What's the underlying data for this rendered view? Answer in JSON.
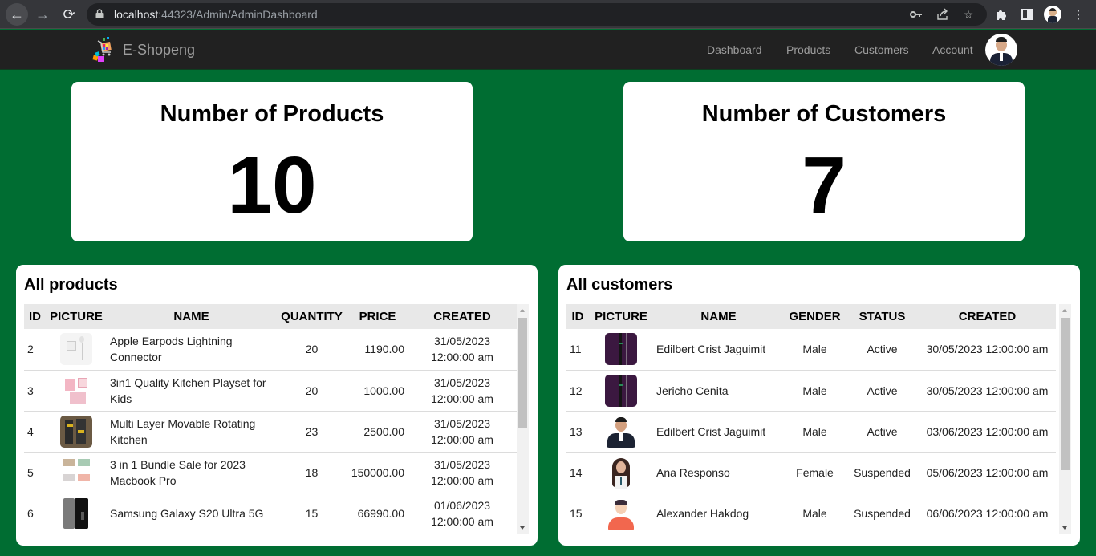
{
  "browser": {
    "url_host": "localhost",
    "url_rest": ":44323/Admin/AdminDashboard",
    "icons": [
      "back-arrow-icon",
      "forward-arrow-icon",
      "reload-icon",
      "lock-icon",
      "key-icon",
      "share-icon",
      "star-icon",
      "extensions-puzzle-icon",
      "sidepanel-icon",
      "profile-avatar",
      "kebab-menu-icon"
    ]
  },
  "navbar": {
    "brand": "E-Shopeng",
    "links": [
      "Dashboard",
      "Products",
      "Customers",
      "Account"
    ]
  },
  "stats": [
    {
      "title": "Number of Products",
      "value": "10"
    },
    {
      "title": "Number of Customers",
      "value": "7"
    }
  ],
  "products": {
    "title": "All products",
    "columns": [
      "ID",
      "PICTURE",
      "NAME",
      "QUANTITY",
      "PRICE",
      "CREATED"
    ],
    "rows": [
      {
        "id": "2",
        "picture": "earpods",
        "name": "Apple Earpods Lightning Connector",
        "quantity": "20",
        "price": "1190.00",
        "created_date": "31/05/2023",
        "created_time": "12:00:00 am"
      },
      {
        "id": "3",
        "picture": "kitchen-playset",
        "name": "3in1 Quality Kitchen Playset for Kids",
        "quantity": "20",
        "price": "1000.00",
        "created_date": "31/05/2023",
        "created_time": "12:00:00 am"
      },
      {
        "id": "4",
        "picture": "rotating-kitchen",
        "name": "Multi Layer Movable Rotating Kitchen",
        "quantity": "23",
        "price": "2500.00",
        "created_date": "31/05/2023",
        "created_time": "12:00:00 am"
      },
      {
        "id": "5",
        "picture": "macbook-bundle",
        "name": "3 in 1 Bundle Sale for 2023 Macbook Pro",
        "quantity": "18",
        "price": "150000.00",
        "created_date": "31/05/2023",
        "created_time": "12:00:00 am"
      },
      {
        "id": "6",
        "picture": "galaxy-s20",
        "name": "Samsung Galaxy S20 Ultra 5G",
        "quantity": "15",
        "price": "66990.00",
        "created_date": "01/06/2023",
        "created_time": "12:00:00 am"
      }
    ]
  },
  "customers": {
    "title": "All customers",
    "columns": [
      "ID",
      "PICTURE",
      "NAME",
      "GENDER",
      "STATUS",
      "CREATED"
    ],
    "rows": [
      {
        "id": "11",
        "picture": "dark-purple",
        "name": "Edilbert Crist Jaguimit",
        "gender": "Male",
        "status": "Active",
        "created": "30/05/2023 12:00:00 am"
      },
      {
        "id": "12",
        "picture": "dark-purple",
        "name": "Jericho Cenita",
        "gender": "Male",
        "status": "Active",
        "created": "30/05/2023 12:00:00 am"
      },
      {
        "id": "13",
        "picture": "man-suit",
        "name": "Edilbert Crist Jaguimit",
        "gender": "Male",
        "status": "Active",
        "created": "03/06/2023 12:00:00 am"
      },
      {
        "id": "14",
        "picture": "woman",
        "name": "Ana Responso",
        "gender": "Female",
        "status": "Suspended",
        "created": "05/06/2023 12:00:00 am"
      },
      {
        "id": "15",
        "picture": "cartoon-man",
        "name": "Alexander Hakdog",
        "gender": "Male",
        "status": "Suspended",
        "created": "06/06/2023 12:00:00 am"
      }
    ]
  },
  "colors": {
    "page_bg": "#006d32",
    "navbar_bg": "#212121",
    "nav_text": "#9d9d9d",
    "table_header_bg": "#e8e8e8"
  }
}
